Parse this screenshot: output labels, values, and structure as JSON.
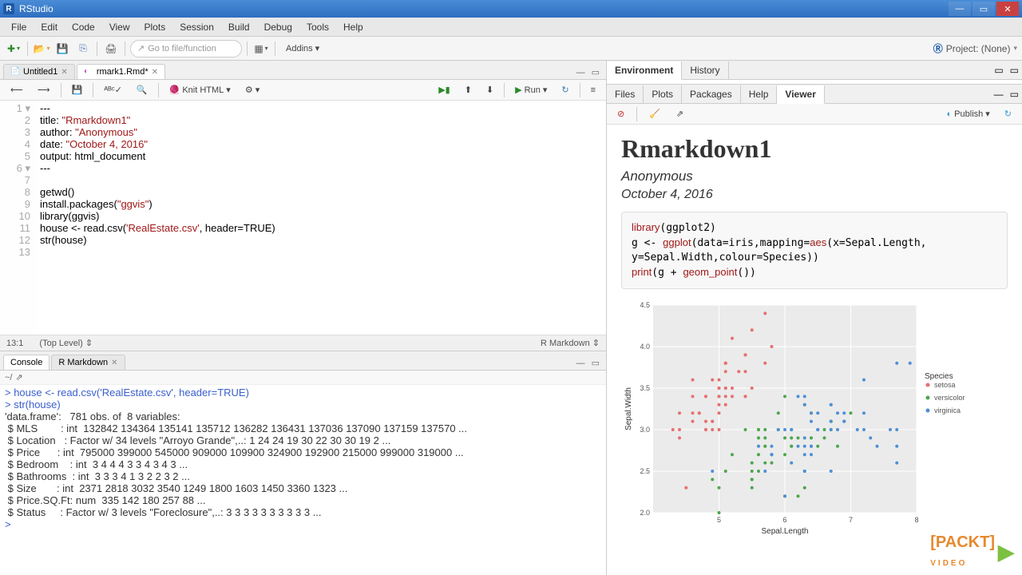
{
  "window": {
    "title": "RStudio"
  },
  "menu": [
    "File",
    "Edit",
    "Code",
    "View",
    "Plots",
    "Session",
    "Build",
    "Debug",
    "Tools",
    "Help"
  ],
  "toolbar": {
    "gotofile": "Go to file/function",
    "addins": "Addins",
    "project": "Project: (None)"
  },
  "source": {
    "tabs": [
      {
        "label": "Untitled1",
        "active": false
      },
      {
        "label": "rmark1.Rmd*",
        "active": true
      }
    ],
    "knit": "Knit HTML",
    "run": "Run",
    "lines": [
      "---",
      "title: \"Rmarkdown1\"",
      "author: \"Anonymous\"",
      "date: \"October 4, 2016\"",
      "output: html_document",
      "---",
      "",
      "getwd()",
      "install.packages(\"ggvis\")",
      "library(ggvis)",
      "house <- read.csv('RealEstate.csv', header=TRUE)",
      "str(house)",
      ""
    ],
    "cursor": "13:1",
    "scope": "(Top Level)",
    "lang": "R Markdown"
  },
  "consoleTabs": [
    {
      "label": "Console",
      "active": true
    },
    {
      "label": "R Markdown",
      "active": false
    }
  ],
  "consolePath": "~/",
  "console": [
    {
      "t": "p",
      "text": "> house <- read.csv('RealEstate.csv', header=TRUE)"
    },
    {
      "t": "p",
      "text": "> str(house)"
    },
    {
      "t": "o",
      "text": "'data.frame':   781 obs. of  8 variables:"
    },
    {
      "t": "o",
      "text": " $ MLS        : int  132842 134364 135141 135712 136282 136431 137036 137090 137159 137570 ..."
    },
    {
      "t": "o",
      "text": " $ Location   : Factor w/ 34 levels \"Arroyo Grande\",..: 1 24 24 19 30 22 30 30 19 2 ..."
    },
    {
      "t": "o",
      "text": " $ Price      : int  795000 399000 545000 909000 109900 324900 192900 215000 999000 319000 ..."
    },
    {
      "t": "o",
      "text": " $ Bedroom    : int  3 4 4 4 3 3 4 3 4 3 ..."
    },
    {
      "t": "o",
      "text": " $ Bathrooms  : int  3 3 3 4 1 3 2 2 3 2 ..."
    },
    {
      "t": "o",
      "text": " $ Size       : int  2371 2818 3032 3540 1249 1800 1603 1450 3360 1323 ..."
    },
    {
      "t": "o",
      "text": " $ Price.SQ.Ft: num  335 142 180 257 88 ..."
    },
    {
      "t": "o",
      "text": " $ Status     : Factor w/ 3 levels \"Foreclosure\",..: 3 3 3 3 3 3 3 3 3 3 ..."
    },
    {
      "t": "p",
      "text": "> "
    }
  ],
  "envTabs": [
    {
      "label": "Environment",
      "active": true
    },
    {
      "label": "History",
      "active": false
    }
  ],
  "fileTabs": [
    {
      "label": "Files",
      "active": false
    },
    {
      "label": "Plots",
      "active": false
    },
    {
      "label": "Packages",
      "active": false
    },
    {
      "label": "Help",
      "active": false
    },
    {
      "label": "Viewer",
      "active": true
    }
  ],
  "publish": "Publish",
  "viewer": {
    "title": "Rmarkdown1",
    "author": "Anonymous",
    "date": "October 4, 2016",
    "code": "library(ggplot2)\ng <- ggplot(data=iris,mapping=aes(x=Sepal.Length, y=Sepal.Width,colour=Species))\nprint(g + geom_point())"
  },
  "chart_data": {
    "type": "scatter",
    "title": "",
    "xlabel": "Sepal.Length",
    "ylabel": "Sepal.Width",
    "xlim": [
      4,
      8
    ],
    "ylim": [
      2.0,
      4.5
    ],
    "xticks": [
      5,
      6,
      7,
      8
    ],
    "yticks": [
      2.0,
      2.5,
      3.0,
      3.5,
      4.0,
      4.5
    ],
    "legend": {
      "title": "Species",
      "entries": [
        "setosa",
        "versicolor",
        "virginica"
      ],
      "colors": [
        "#e76f6f",
        "#4da64d",
        "#4d8fd6"
      ]
    },
    "series": [
      {
        "name": "setosa",
        "color": "#e76f6f",
        "points": [
          [
            5.1,
            3.5
          ],
          [
            4.9,
            3.0
          ],
          [
            4.7,
            3.2
          ],
          [
            4.6,
            3.1
          ],
          [
            5.0,
            3.6
          ],
          [
            5.4,
            3.9
          ],
          [
            4.6,
            3.4
          ],
          [
            5.0,
            3.4
          ],
          [
            4.4,
            2.9
          ],
          [
            4.9,
            3.1
          ],
          [
            5.4,
            3.7
          ],
          [
            4.8,
            3.4
          ],
          [
            4.8,
            3.0
          ],
          [
            4.3,
            3.0
          ],
          [
            5.8,
            4.0
          ],
          [
            5.7,
            4.4
          ],
          [
            5.4,
            3.9
          ],
          [
            5.1,
            3.5
          ],
          [
            5.7,
            3.8
          ],
          [
            5.1,
            3.8
          ],
          [
            5.4,
            3.4
          ],
          [
            5.1,
            3.7
          ],
          [
            4.6,
            3.6
          ],
          [
            5.1,
            3.3
          ],
          [
            4.8,
            3.4
          ],
          [
            5.0,
            3.0
          ],
          [
            5.0,
            3.4
          ],
          [
            5.2,
            3.5
          ],
          [
            5.2,
            3.4
          ],
          [
            4.7,
            3.2
          ],
          [
            4.8,
            3.1
          ],
          [
            5.4,
            3.4
          ],
          [
            5.2,
            4.1
          ],
          [
            5.5,
            4.2
          ],
          [
            4.9,
            3.1
          ],
          [
            5.0,
            3.2
          ],
          [
            5.5,
            3.5
          ],
          [
            4.9,
            3.6
          ],
          [
            4.4,
            3.0
          ],
          [
            5.1,
            3.4
          ],
          [
            5.0,
            3.5
          ],
          [
            4.5,
            2.3
          ],
          [
            4.4,
            3.2
          ],
          [
            5.0,
            3.5
          ],
          [
            5.1,
            3.8
          ],
          [
            4.8,
            3.0
          ],
          [
            5.1,
            3.8
          ],
          [
            4.6,
            3.2
          ],
          [
            5.3,
            3.7
          ],
          [
            5.0,
            3.3
          ]
        ]
      },
      {
        "name": "versicolor",
        "color": "#4da64d",
        "points": [
          [
            7.0,
            3.2
          ],
          [
            6.4,
            3.2
          ],
          [
            6.9,
            3.1
          ],
          [
            5.5,
            2.3
          ],
          [
            6.5,
            2.8
          ],
          [
            5.7,
            2.8
          ],
          [
            6.3,
            3.3
          ],
          [
            4.9,
            2.4
          ],
          [
            6.6,
            2.9
          ],
          [
            5.2,
            2.7
          ],
          [
            5.0,
            2.0
          ],
          [
            5.9,
            3.0
          ],
          [
            6.0,
            2.2
          ],
          [
            6.1,
            2.9
          ],
          [
            5.6,
            2.9
          ],
          [
            6.7,
            3.1
          ],
          [
            5.6,
            3.0
          ],
          [
            5.8,
            2.7
          ],
          [
            6.2,
            2.2
          ],
          [
            5.6,
            2.5
          ],
          [
            5.9,
            3.2
          ],
          [
            6.1,
            2.8
          ],
          [
            6.3,
            2.5
          ],
          [
            6.1,
            2.8
          ],
          [
            6.4,
            2.9
          ],
          [
            6.6,
            3.0
          ],
          [
            6.8,
            2.8
          ],
          [
            6.7,
            3.0
          ],
          [
            6.0,
            2.9
          ],
          [
            5.7,
            2.6
          ],
          [
            5.5,
            2.4
          ],
          [
            5.5,
            2.4
          ],
          [
            5.8,
            2.7
          ],
          [
            6.0,
            2.7
          ],
          [
            5.4,
            3.0
          ],
          [
            6.0,
            3.4
          ],
          [
            6.7,
            3.1
          ],
          [
            6.3,
            2.3
          ],
          [
            5.6,
            3.0
          ],
          [
            5.5,
            2.5
          ],
          [
            5.5,
            2.6
          ],
          [
            6.1,
            3.0
          ],
          [
            5.8,
            2.6
          ],
          [
            5.0,
            2.3
          ],
          [
            5.6,
            2.7
          ],
          [
            5.7,
            3.0
          ],
          [
            5.7,
            2.9
          ],
          [
            6.2,
            2.9
          ],
          [
            5.1,
            2.5
          ],
          [
            5.7,
            2.8
          ]
        ]
      },
      {
        "name": "virginica",
        "color": "#4d8fd6",
        "points": [
          [
            6.3,
            3.3
          ],
          [
            5.8,
            2.7
          ],
          [
            7.1,
            3.0
          ],
          [
            6.3,
            2.9
          ],
          [
            6.5,
            3.0
          ],
          [
            7.6,
            3.0
          ],
          [
            4.9,
            2.5
          ],
          [
            7.3,
            2.9
          ],
          [
            6.7,
            2.5
          ],
          [
            7.2,
            3.6
          ],
          [
            6.5,
            3.2
          ],
          [
            6.4,
            2.7
          ],
          [
            6.8,
            3.0
          ],
          [
            5.7,
            2.5
          ],
          [
            5.8,
            2.8
          ],
          [
            6.4,
            3.2
          ],
          [
            6.5,
            3.0
          ],
          [
            7.7,
            3.8
          ],
          [
            7.7,
            2.6
          ],
          [
            6.0,
            2.2
          ],
          [
            6.9,
            3.2
          ],
          [
            5.6,
            2.8
          ],
          [
            7.7,
            2.8
          ],
          [
            6.3,
            2.7
          ],
          [
            6.7,
            3.3
          ],
          [
            7.2,
            3.2
          ],
          [
            6.2,
            2.8
          ],
          [
            6.1,
            3.0
          ],
          [
            6.4,
            2.8
          ],
          [
            7.2,
            3.0
          ],
          [
            7.4,
            2.8
          ],
          [
            7.9,
            3.8
          ],
          [
            6.4,
            2.8
          ],
          [
            6.3,
            2.8
          ],
          [
            6.1,
            2.6
          ],
          [
            7.7,
            3.0
          ],
          [
            6.3,
            3.4
          ],
          [
            6.4,
            3.1
          ],
          [
            6.0,
            3.0
          ],
          [
            6.9,
            3.1
          ],
          [
            6.7,
            3.1
          ],
          [
            6.9,
            3.1
          ],
          [
            5.8,
            2.7
          ],
          [
            6.8,
            3.2
          ],
          [
            6.7,
            3.3
          ],
          [
            6.7,
            3.0
          ],
          [
            6.3,
            2.5
          ],
          [
            6.5,
            3.0
          ],
          [
            6.2,
            3.4
          ],
          [
            5.9,
            3.0
          ]
        ]
      }
    ]
  },
  "watermark": {
    "brand": "PACKT",
    "sub": "VIDEO"
  }
}
